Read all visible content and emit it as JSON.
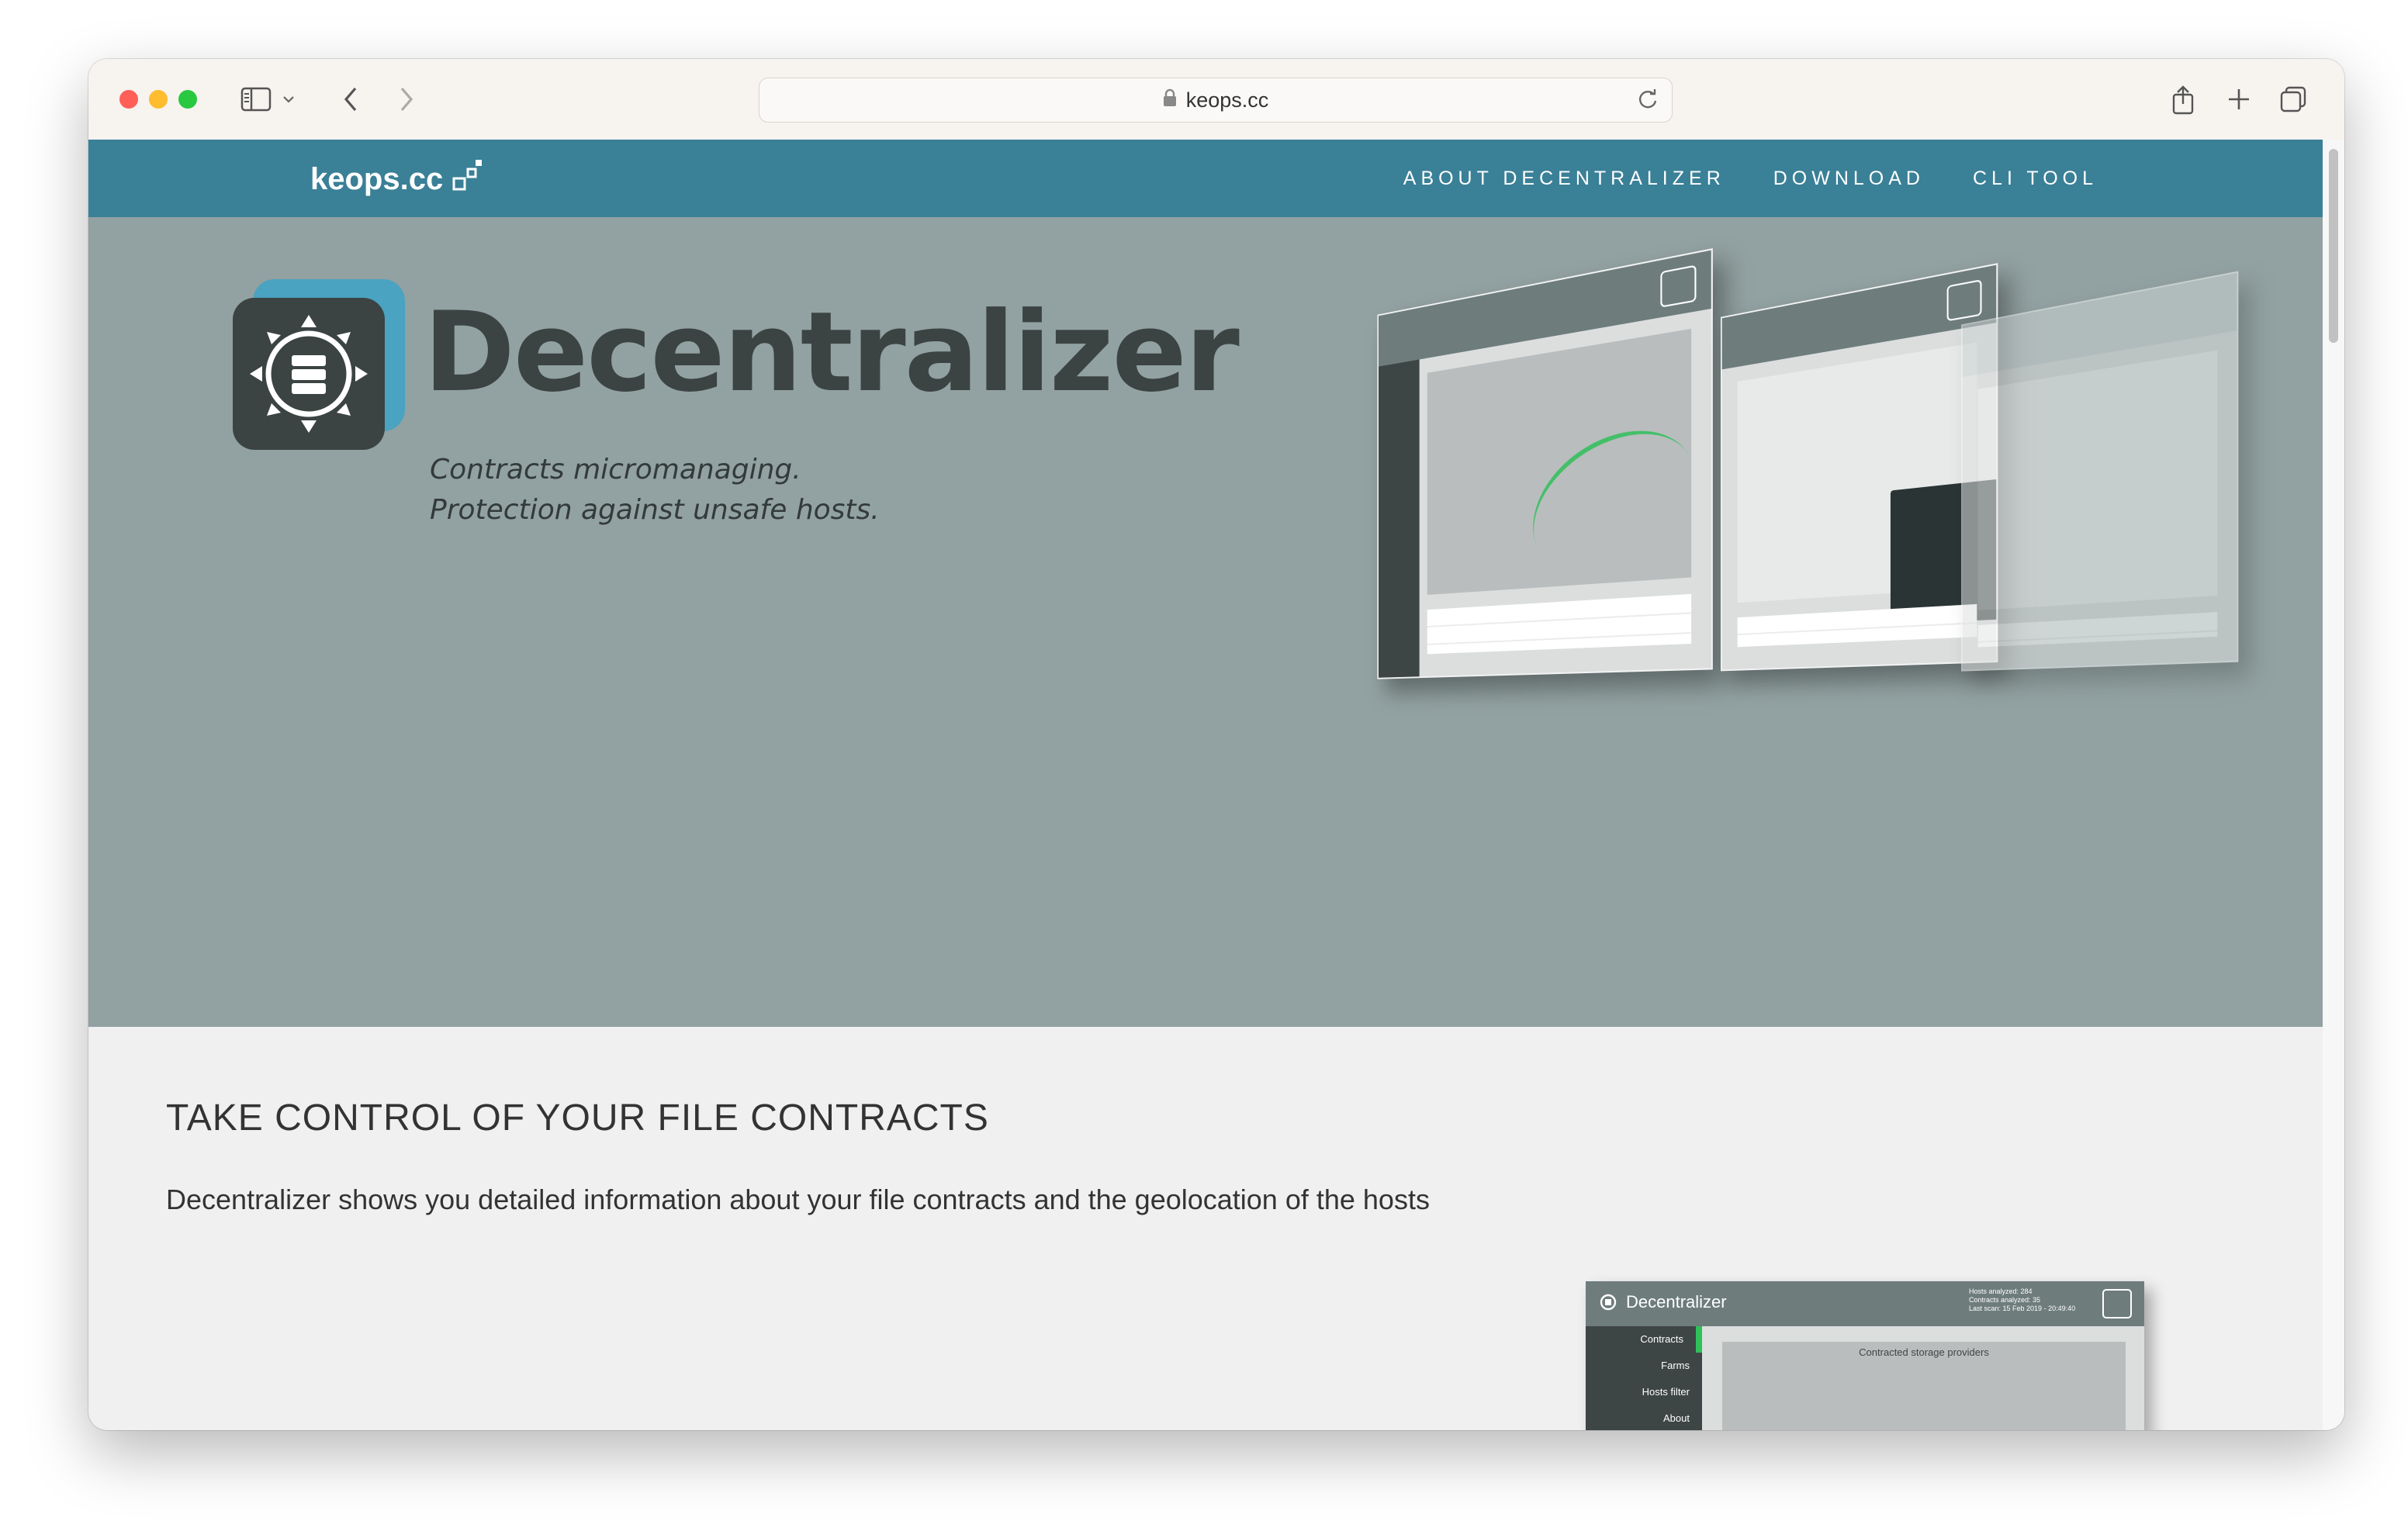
{
  "browser": {
    "url": "keops.cc"
  },
  "site": {
    "brand": "keops.cc",
    "nav": [
      {
        "label": "ABOUT DECENTRALIZER"
      },
      {
        "label": "DOWNLOAD"
      },
      {
        "label": "CLI TOOL"
      }
    ]
  },
  "hero": {
    "title": "Decentralizer",
    "tagline_line1": "Contracts micromanaging.",
    "tagline_line2": "Protection against unsafe hosts."
  },
  "section": {
    "title": "TAKE CONTROL OF YOUR FILE CONTRACTS",
    "text": "Decentralizer shows you detailed information about your file contracts and the geolocation of the hosts"
  },
  "preview": {
    "brand": "Decentralizer",
    "stats": [
      "Hosts analyzed: 284",
      "Contracts analyzed: 35",
      "Last scan: 15 Feb 2019 - 20:49:40"
    ],
    "menu": [
      "Contracts",
      "Farms",
      "Hosts filter",
      "About"
    ],
    "map_title": "Contracted storage providers"
  },
  "colors": {
    "nav_bg": "#3a8097",
    "hero_bg": "#92a1a1",
    "accent_green": "#2fc05a"
  }
}
